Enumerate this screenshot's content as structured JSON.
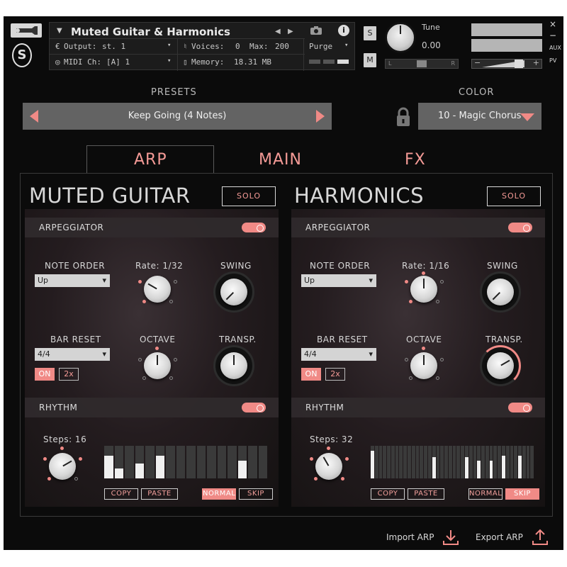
{
  "header": {
    "instrument_name": "Muted Guitar & Harmonics",
    "output_label": "Output:",
    "output_value": "st. 1",
    "voices_label": "Voices:",
    "voices_value": "0",
    "max_label": "Max:",
    "max_value": "200",
    "purge_label": "Purge",
    "midi_label": "MIDI Ch:",
    "midi_value": "[A]  1",
    "memory_label": "Memory:",
    "memory_value": "18.31 MB",
    "solo_label": "S",
    "mute_label": "M",
    "tune_label": "Tune",
    "tune_value": "0.00",
    "pan_left": "L",
    "pan_right": "R",
    "vol_minus": "−",
    "vol_plus": "+",
    "close": "×",
    "minimize": "−",
    "aux": "AUX",
    "pv": "PV"
  },
  "presets": {
    "label": "PRESETS",
    "current": "Keep Going (4 Notes)"
  },
  "color": {
    "label": "COLOR",
    "current": "10 - Magic Chorus"
  },
  "tabs": [
    {
      "label": "ARP",
      "active": true
    },
    {
      "label": "MAIN",
      "active": false
    },
    {
      "label": "FX",
      "active": false
    }
  ],
  "panels": [
    {
      "title": "MUTED GUITAR",
      "solo": "SOLO",
      "arpeggiator_label": "ARPEGGIATOR",
      "note_order_label": "NOTE ORDER",
      "note_order_value": "Up",
      "rate_label": "Rate: 1/32",
      "swing_label": "SWING",
      "bar_reset_label": "BAR RESET",
      "bar_reset_value": "4/4",
      "octave_label": "OCTAVE",
      "transp_label": "TRANSP.",
      "on_label": "ON",
      "x2_label": "2x",
      "rhythm_label": "RHYTHM",
      "steps_label": "Steps: 16",
      "copy": "COPY",
      "paste": "PASTE",
      "normal": "NORMAL",
      "skip": "SKIP",
      "mode_selected": "normal",
      "step_levels": [
        0.7,
        0.3,
        0.0,
        0.45,
        0.0,
        0.7,
        0.0,
        0.0,
        0.0,
        0.0,
        0.0,
        0.0,
        0.0,
        0.55,
        0.0,
        0.0
      ]
    },
    {
      "title": "HARMONICS",
      "solo": "SOLO",
      "arpeggiator_label": "ARPEGGIATOR",
      "note_order_label": "NOTE ORDER",
      "note_order_value": "Up",
      "rate_label": "Rate: 1/16",
      "swing_label": "SWING",
      "bar_reset_label": "BAR RESET",
      "bar_reset_value": "4/4",
      "octave_label": "OCTAVE",
      "transp_label": "TRANSP.",
      "on_label": "ON",
      "x2_label": "2x",
      "rhythm_label": "RHYTHM",
      "steps_label": "Steps: 32",
      "copy": "COPY",
      "paste": "PASTE",
      "normal": "NORMAL",
      "skip": "SKIP",
      "mode_selected": "skip",
      "step_levels": [
        0.85,
        0.0,
        0.0,
        0.0,
        0.0,
        0.0,
        0.0,
        0.0,
        0.0,
        0.0,
        0.0,
        0.0,
        0.0,
        0.0,
        0.0,
        0.65,
        0.0,
        0.0,
        0.0,
        0.0,
        0.0,
        0.0,
        0.0,
        0.65,
        0.0,
        0.0,
        0.55,
        0.0,
        0.0,
        0.55,
        0.0,
        0.0,
        0.7,
        0.0,
        0.0,
        0.0,
        0.7,
        0.0,
        0.0,
        0.0
      ]
    }
  ],
  "footer": {
    "import": "Import ARP",
    "export": "Export ARP"
  },
  "accent_color": "#f08a86"
}
